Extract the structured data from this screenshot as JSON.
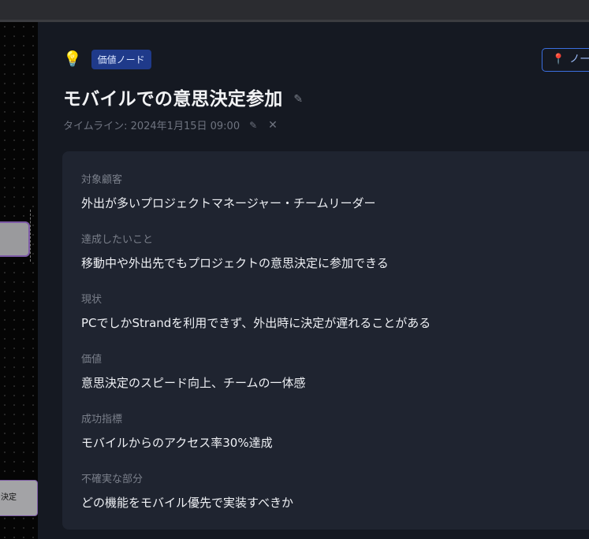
{
  "canvas": {
    "node_b_label": "の決定"
  },
  "header": {
    "bulb_icon": "💡",
    "badge": "価値ノード",
    "node_button": {
      "icon": "📍",
      "label": "ノー"
    }
  },
  "title": {
    "text": "モバイルでの意思決定参加",
    "edit_icon": "✎"
  },
  "timeline": {
    "text": "タイムライン: 2024年1月15日 09:00",
    "edit_icon": "✎",
    "clear_icon": "✕"
  },
  "fields": [
    {
      "label": "対象顧客",
      "value": "外出が多いプロジェクトマネージャー・チームリーダー"
    },
    {
      "label": "達成したいこと",
      "value": "移動中や外出先でもプロジェクトの意思決定に参加できる"
    },
    {
      "label": "現状",
      "value": "PCでしかStrandを利用できず、外出時に決定が遅れることがある"
    },
    {
      "label": "価値",
      "value": "意思決定のスピード向上、チームの一体感"
    },
    {
      "label": "成功指標",
      "value": "モバイルからのアクセス率30%達成"
    },
    {
      "label": "不確実な部分",
      "value": "どの機能をモバイル優先で実装すべきか"
    }
  ],
  "colors": {
    "badge_bg": "#1f3a8a",
    "accent_border": "#3b6fe0",
    "panel_bg": "#151922",
    "card_bg": "#1f2430"
  }
}
